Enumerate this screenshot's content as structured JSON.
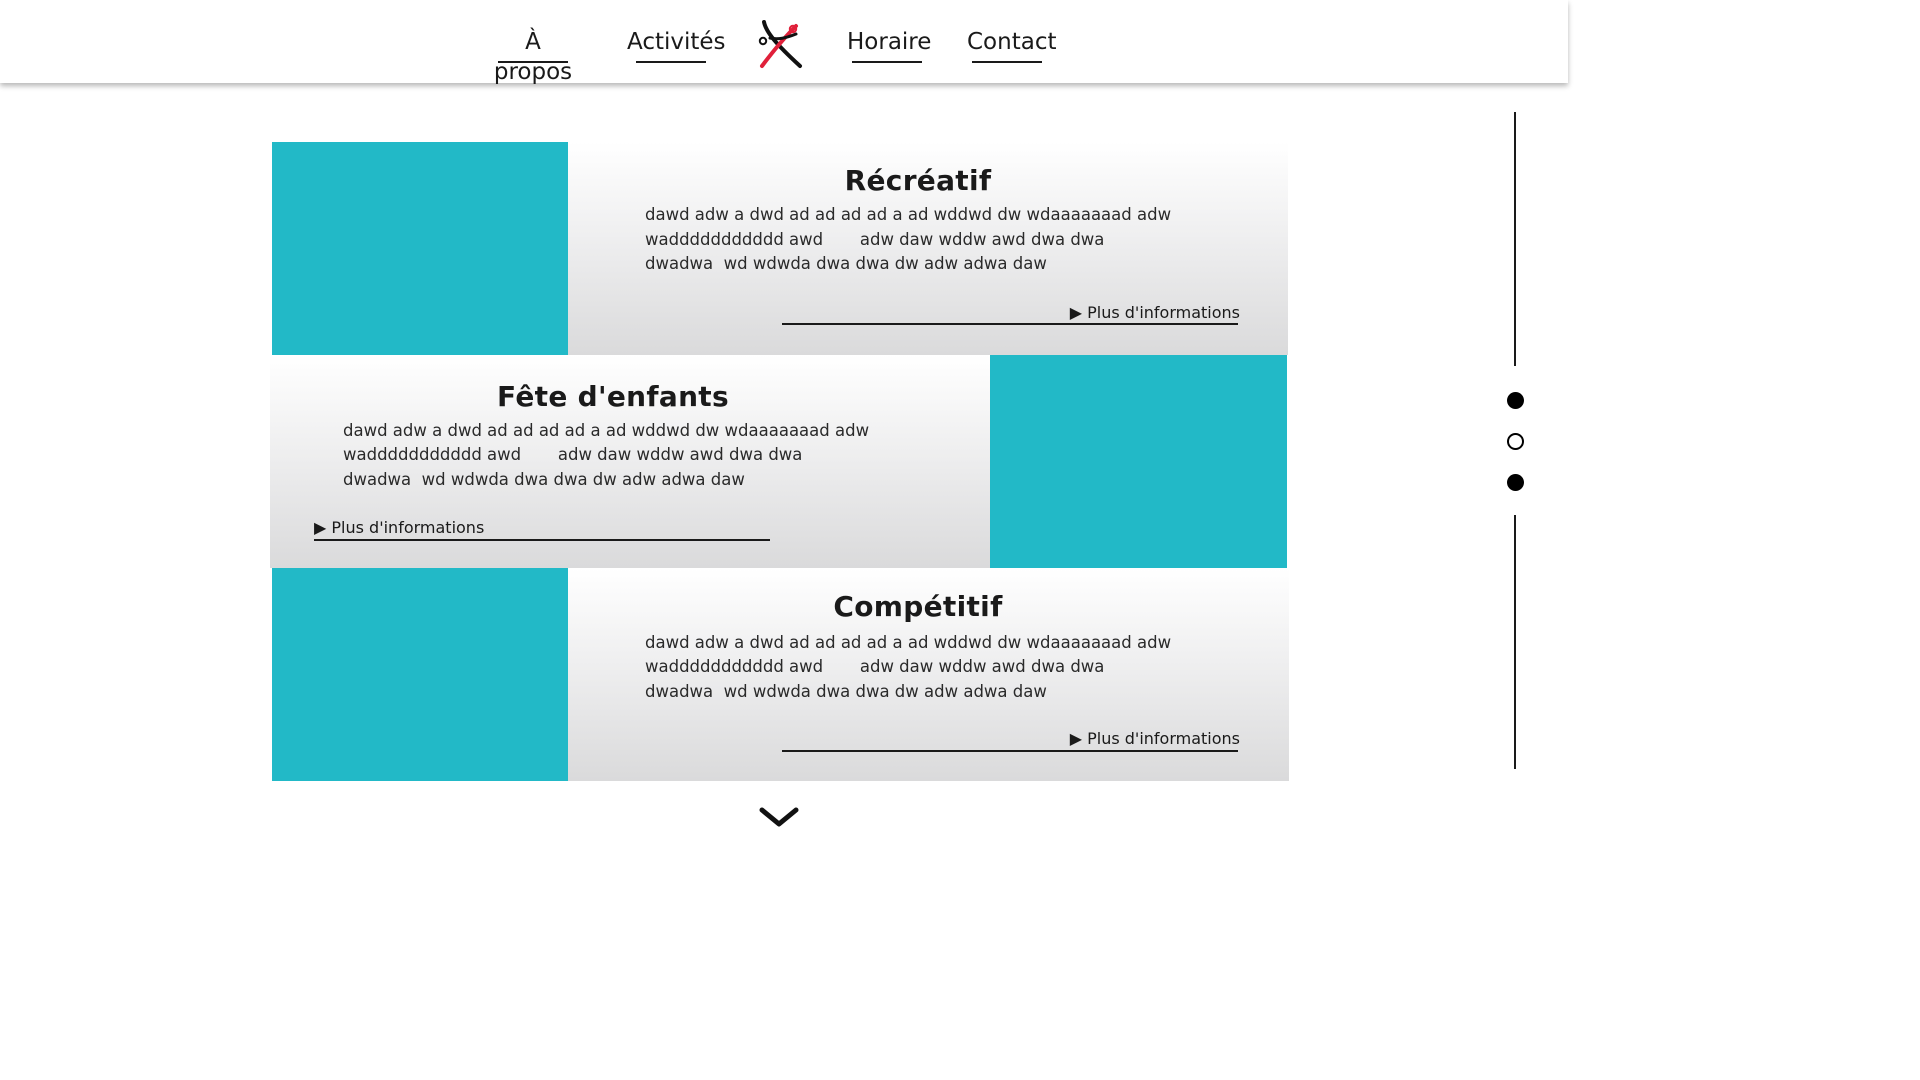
{
  "nav": {
    "left": [
      {
        "label": "À propos"
      },
      {
        "label": "Activités"
      }
    ],
    "right": [
      {
        "label": "Horaire"
      },
      {
        "label": "Contact"
      }
    ],
    "logo_icon": "dancer-logo-icon"
  },
  "activities": [
    {
      "title": "Récréatif",
      "lines": [
        "dawd adw a dwd ad ad ad ad a ad wddwd dw wdaaaaaaad adw",
        "waddddddddddd awd       adw daw wddw awd dwa dwa",
        "dwadwa  wd wdwda dwa dwa dw adw adwa daw"
      ],
      "more_label": "▶ Plus d'informations"
    },
    {
      "title": "Fête d'enfants",
      "lines": [
        "dawd adw a dwd ad ad ad ad a ad wddwd dw wdaaaaaaad adw",
        "waddddddddddd awd       adw daw wddw awd dwa dwa",
        "dwadwa  wd wdwda dwa dwa dw adw adwa daw"
      ],
      "more_label": "▶ Plus d'informations"
    },
    {
      "title": "Compétitif",
      "lines": [
        "dawd adw a dwd ad ad ad ad a ad wddwd dw wdaaaaaaad adw",
        "waddddddddddd awd       adw daw wddw awd dwa dwa",
        "dwadwa  wd wdwda dwa dwa dw adw adwa daw"
      ],
      "more_label": "▶ Plus d'informations"
    }
  ],
  "scroll_indicator": {
    "dots": [
      "filled",
      "empty",
      "filled"
    ]
  },
  "colors": {
    "accent_teal": "#22b9c7",
    "text": "#1a1a1a",
    "logo_red": "#e0203a"
  },
  "scroll_down_icon": "chevron-down-icon"
}
